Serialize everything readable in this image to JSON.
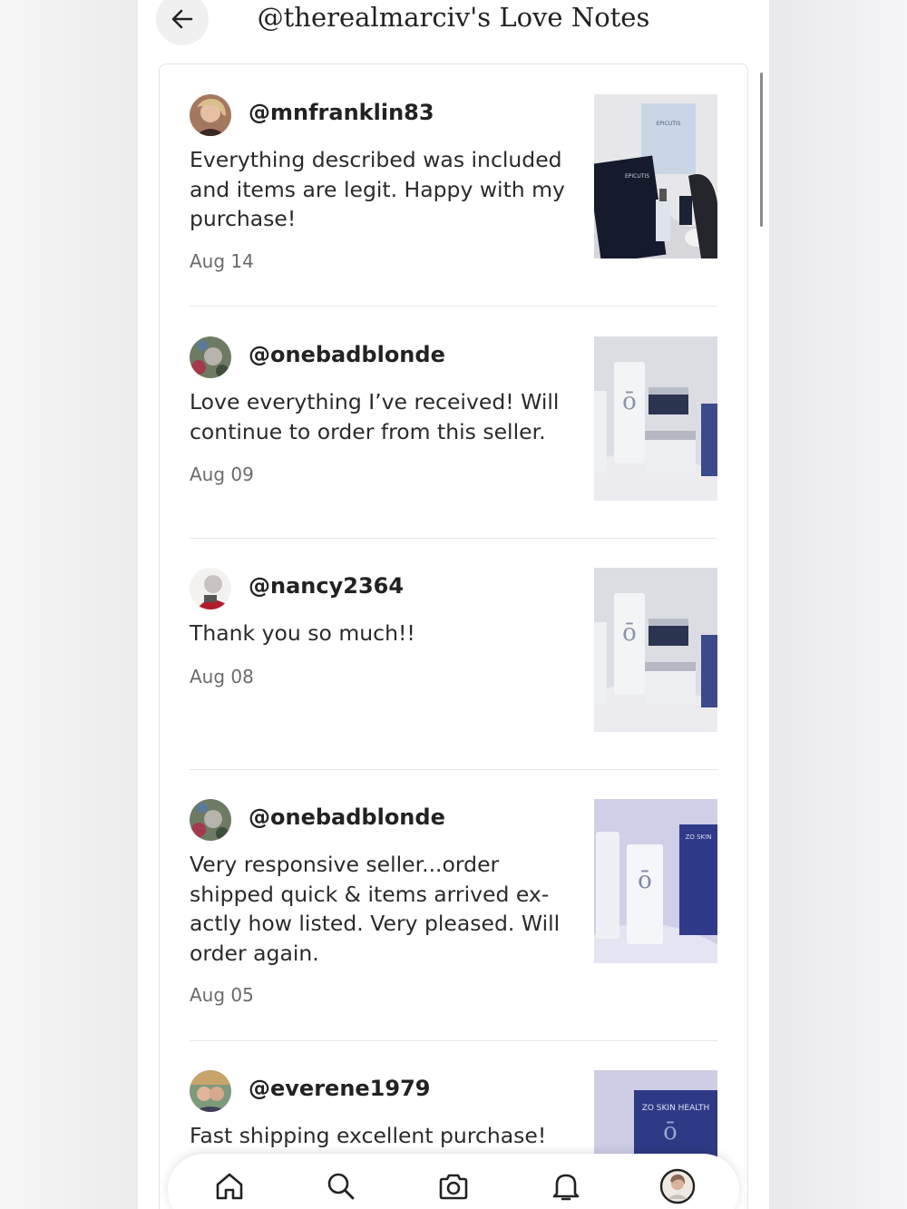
{
  "header": {
    "title": "@therealmarciv's Love Notes",
    "back_icon": "arrow-left-icon"
  },
  "notes": [
    {
      "username": "@mnfranklin83",
      "text": "Everything described was included and items are legit. Happy with my purchase!",
      "date": "Aug 14",
      "image_labels": [
        "EPICUTIS",
        "EPICUTIS"
      ]
    },
    {
      "username": "@onebadblonde",
      "text": "Love everything I’ve received! Will continue to order from this seller.",
      "date": "Aug 09"
    },
    {
      "username": "@nancy2364",
      "text": "Thank you so much!!",
      "date": "Aug 08"
    },
    {
      "username": "@onebadblonde",
      "text": "Very responsive seller...order shipped quick & items arrived ex- actly how listed. Very pleased. Will order again.",
      "date": "Aug 05",
      "image_labels": [
        "ZO SKIN"
      ]
    },
    {
      "username": "@everene1979",
      "text": "Fast shipping excellent purchase!",
      "date": "",
      "image_labels": [
        "ZO SKIN HEALTH"
      ]
    }
  ],
  "bottom_nav": [
    {
      "icon": "home-icon"
    },
    {
      "icon": "search-icon"
    },
    {
      "icon": "camera-icon"
    },
    {
      "icon": "bell-icon"
    },
    {
      "icon": "profile-avatar-icon"
    }
  ],
  "colors": {
    "background": "#ffffff",
    "text": "#222222",
    "muted": "#6b6b6b",
    "divider": "#e6e6e6"
  }
}
